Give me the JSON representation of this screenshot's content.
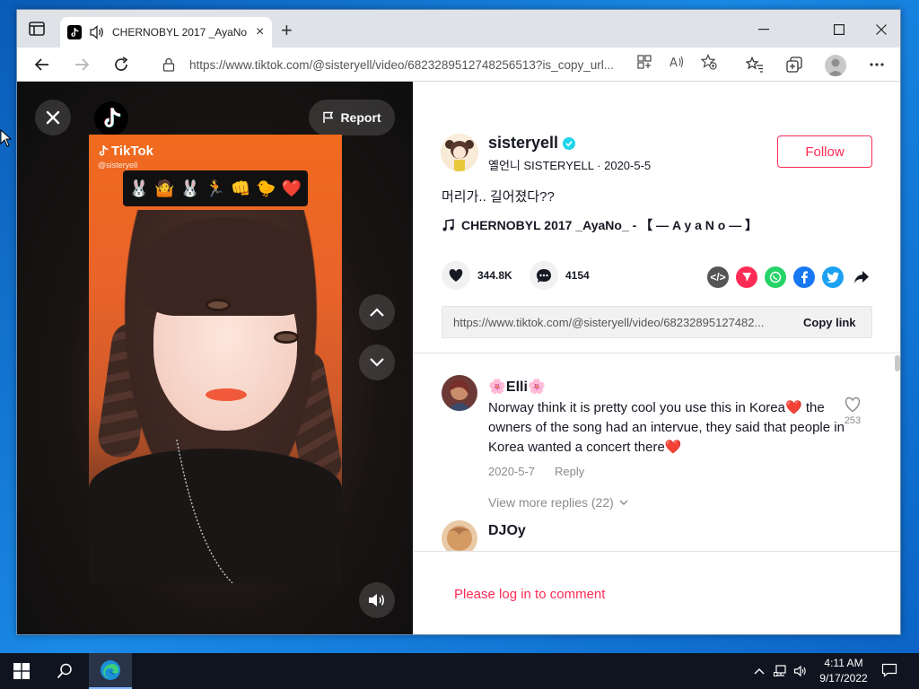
{
  "browser": {
    "tab": {
      "title": "CHERNOBYL 2017 _AyaNo_",
      "close": "×"
    },
    "new_tab": "+",
    "url": "https://www.tiktok.com/@sisteryell/video/6823289512748256513?is_copy_url..."
  },
  "video": {
    "report_label": "Report",
    "watermark_brand": "TikTok",
    "watermark_user": "@sisteryell",
    "emoji_strip": [
      "🐰",
      "🤷",
      "🐰",
      "🏃",
      "👊",
      "🐤",
      "❤️"
    ]
  },
  "post": {
    "author": "sisteryell",
    "display_name": "옐언니 SISTERYELL",
    "date": "2020-5-5",
    "follow_label": "Follow",
    "caption": "머리가.. 길어졌다??",
    "music": "CHERNOBYL 2017 _AyaNo_ - 【 ― A y a N o ― 】",
    "likes": "344.8K",
    "comments_count": "4154",
    "share_icons": [
      "embed-icon",
      "send-icon",
      "whatsapp-icon",
      "facebook-icon",
      "twitter-icon",
      "share-arrow-icon"
    ],
    "share_colors": [
      "#555555",
      "#fe2c55",
      "#25d366",
      "#1877f2",
      "#1da1f2",
      "#161823"
    ],
    "link": "https://www.tiktok.com/@sisteryell/video/68232895127482...",
    "copy_link_label": "Copy link"
  },
  "comments": [
    {
      "name": "Elli",
      "name_prefix": "🌸",
      "name_suffix": "🌸",
      "text": "Norway think it is pretty cool you use this in Korea❤️ the owners of the song had an intervue, they said that people in Korea wanted a concert there❤️",
      "date": "2020-5-7",
      "reply_label": "Reply",
      "likes": "253",
      "more_replies": "View more replies (22)"
    },
    {
      "name": "DJOy"
    }
  ],
  "login_prompt": "Please log in to comment",
  "taskbar": {
    "time": "4:11 AM",
    "date": "9/17/2022"
  }
}
